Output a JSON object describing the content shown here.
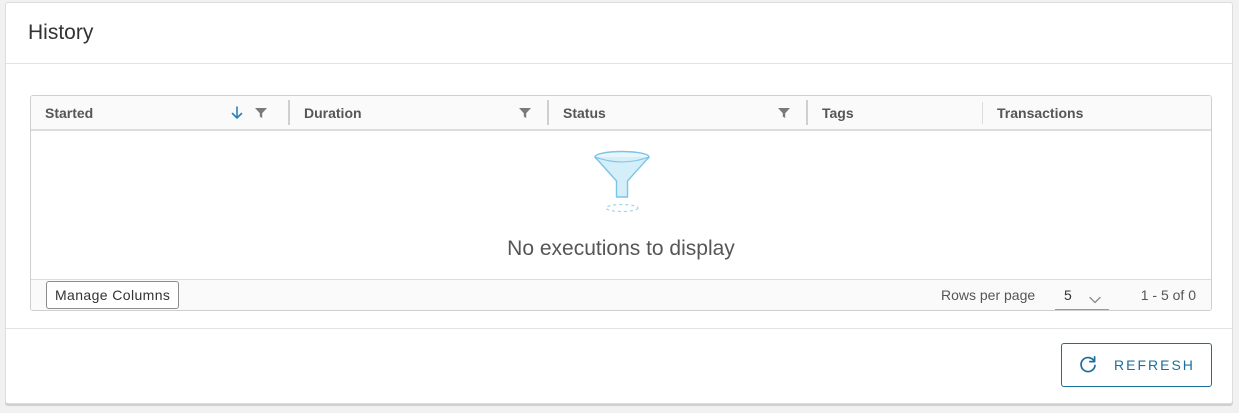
{
  "card": {
    "title": "History"
  },
  "grid": {
    "columns": [
      {
        "label": "Started",
        "sort_icon": "arrow-down-icon",
        "filter_icon": "filter-icon"
      },
      {
        "label": "Duration",
        "filter_icon": "filter-icon"
      },
      {
        "label": "Status",
        "filter_icon": "filter-icon"
      },
      {
        "label": "Tags"
      },
      {
        "label": "Transactions"
      }
    ],
    "empty_icon": "funnel-icon",
    "empty_message": "No executions to display",
    "footer": {
      "manage_columns_label": "Manage Columns",
      "rows_per_page_label": "Rows per page",
      "rows_per_page_value": "5",
      "pagination_text": "1 - 5 of 0"
    }
  },
  "actions": {
    "refresh_label": "REFRESH",
    "refresh_icon": "refresh-icon"
  },
  "colors": {
    "accent": "#1c6f9c",
    "sort_arrow": "#2a7fc1",
    "filter_icon": "#7a7a7a",
    "empty_funnel": "#9fd3ee"
  }
}
